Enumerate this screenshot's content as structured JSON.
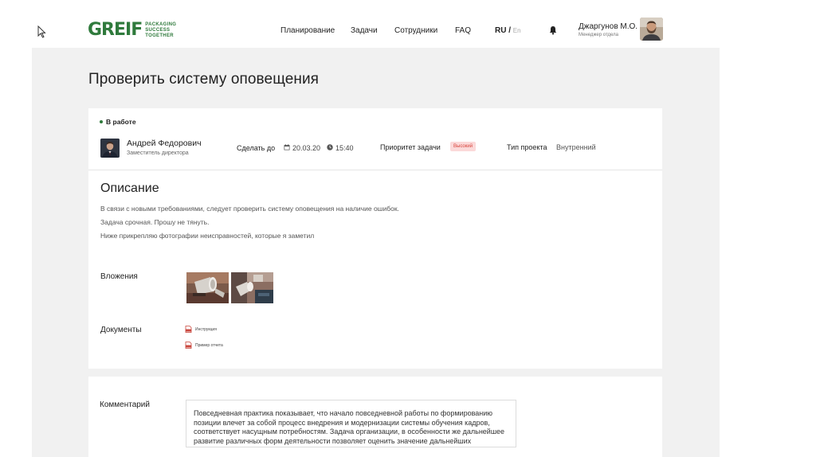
{
  "logo": {
    "word": "GREIF",
    "tagline": [
      "PACKAGING",
      "SUCCESS",
      "TOGETHER"
    ]
  },
  "nav": {
    "items": [
      {
        "label": "Планирование"
      },
      {
        "label": "Задачи"
      },
      {
        "label": "Сотрудники"
      },
      {
        "label": "FAQ"
      }
    ]
  },
  "lang": {
    "current": "RU",
    "separator": "/",
    "other": "En"
  },
  "user": {
    "name": "Джаргунов М.О.",
    "role": "Менеджер отдела"
  },
  "task": {
    "title": "Проверить систему оповещения",
    "status": "В работе",
    "author": {
      "name": "Андрей Федорович",
      "role": "Заместитель директора"
    },
    "due_label": "Сделать до",
    "due_date": "20.03.20",
    "due_time": "15:40",
    "priority_label": "Приоритет задачи",
    "priority_value": "Высокий",
    "type_label": "Тип проекта",
    "type_value": "Внутренний"
  },
  "description": {
    "title": "Описание",
    "lines": [
      "В связи с новыми требованиями, следует проверить систему оповещения на наличие ошибок.",
      "Задача срочная. Прошу не тянуть.",
      "Ниже прикрепляю фотографии неисправностей, которые я заметил"
    ]
  },
  "attachments": {
    "label": "Вложения"
  },
  "documents": {
    "label": "Документы",
    "items": [
      {
        "name": "Инструкция"
      },
      {
        "name": "Пример отчета"
      }
    ]
  },
  "comment": {
    "label": "Комментарий",
    "text": "Повседневная практика показывает, что начало повседневной работы по формированию позиции влечет за собой процесс внедрения и модернизации системы обучения кадров, соответствует насущным потребностям. Задача организации, в особенности же дальнейшее развитие различных форм деятельности позволяет оценить значение дальнейших"
  },
  "colors": {
    "brand": "#2f7a3c",
    "priority_bg": "#fbd9d9",
    "priority_text": "#d8453d",
    "background": "#f1f1f1"
  }
}
